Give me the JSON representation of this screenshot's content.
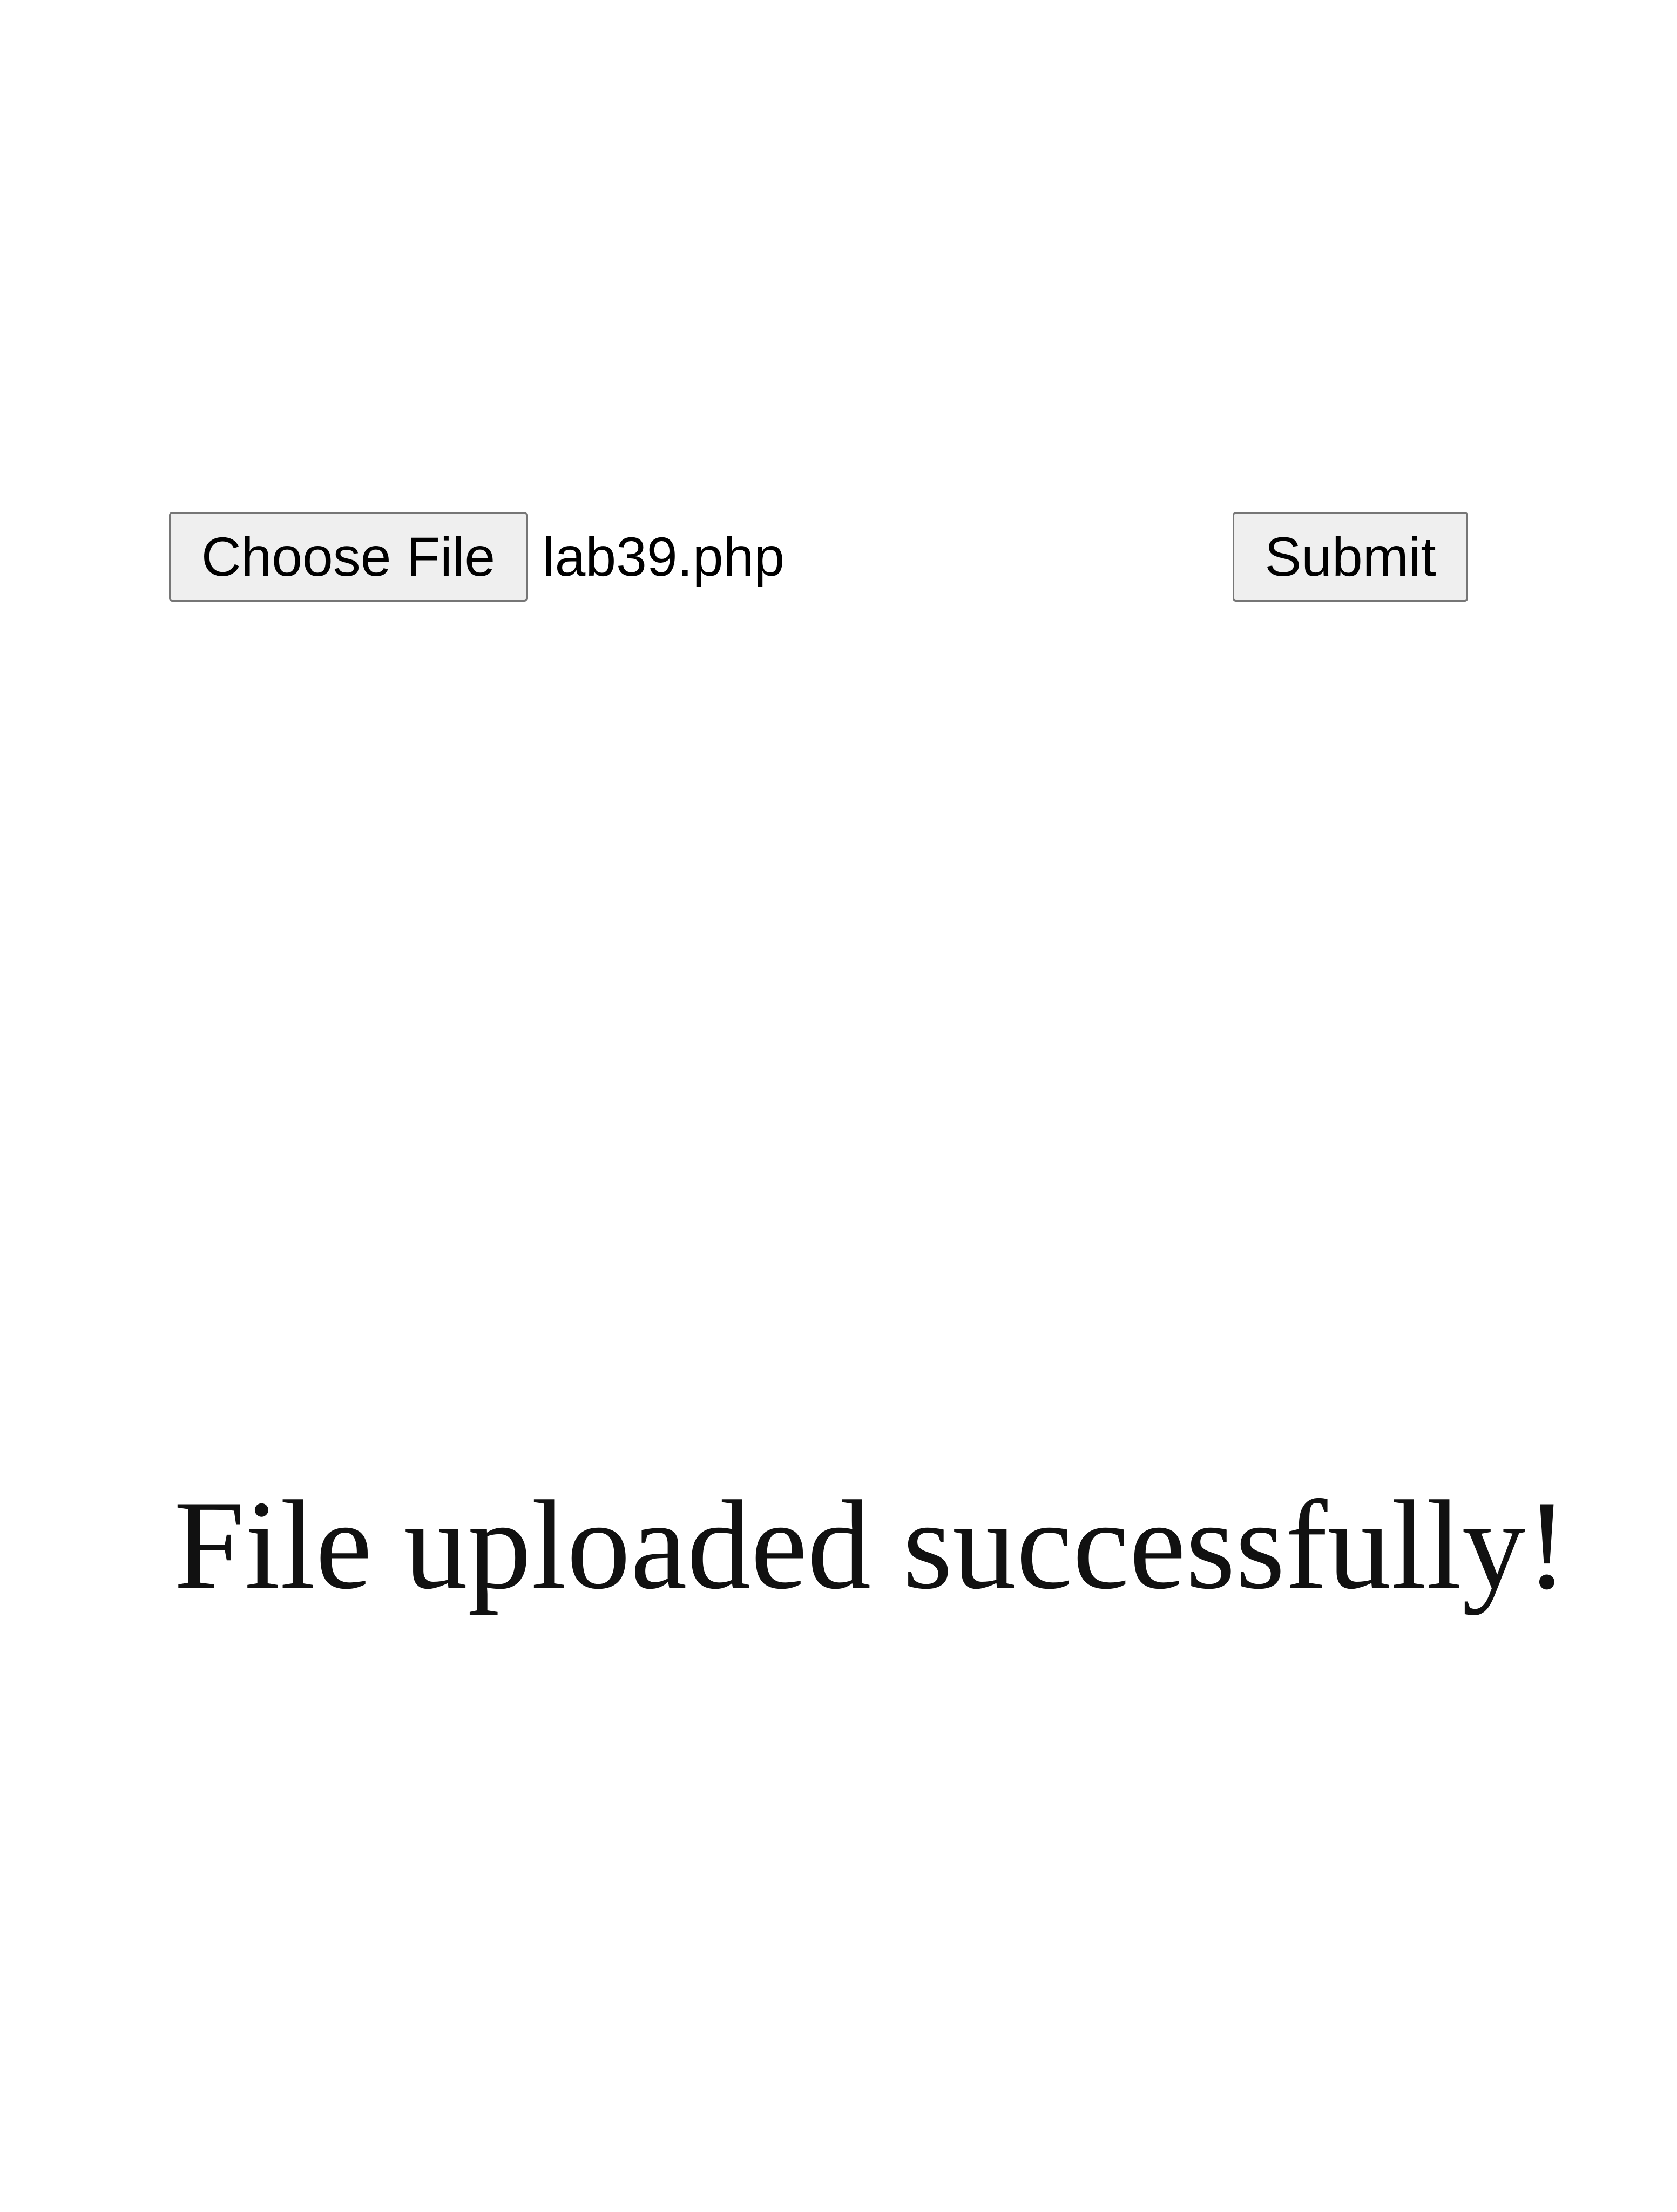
{
  "upload_form": {
    "choose_file_label": "Choose File",
    "selected_file_name": "lab39.php",
    "submit_label": "Submit"
  },
  "status": {
    "message": "File uploaded successfully!"
  }
}
